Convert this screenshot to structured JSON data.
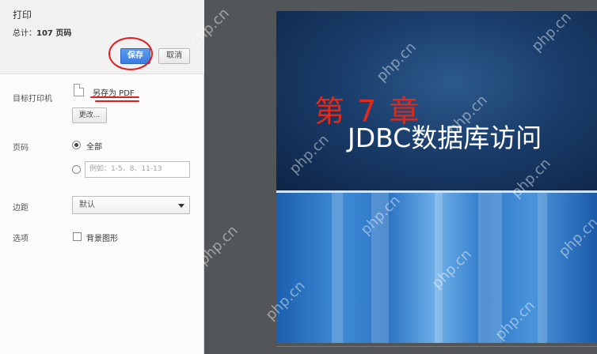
{
  "print_panel": {
    "title": "打印",
    "total_prefix": "总计：",
    "total_count": "107 页码",
    "save_label": "保存",
    "cancel_label": "取消",
    "destination_label": "目标打印机",
    "destination_value": "另存为 PDF",
    "change_label": "更改...",
    "pages_label": "页码",
    "pages_all_label": "全部",
    "pages_placeholder": "例如：1-5、8、11-13",
    "margins_label": "边距",
    "margins_value": "默认",
    "options_label": "选项",
    "background_graphics_label": "背景图形"
  },
  "preview": {
    "chapter": "第 7 章",
    "slide_title": "JDBC数据库访问",
    "watermark": "php.cn"
  },
  "colors": {
    "save_button": "#3b7ae0",
    "annotation_red": "#e21d1d",
    "chapter_red": "#e02a1a",
    "slide_dark_blue": "#1a3d6b"
  }
}
